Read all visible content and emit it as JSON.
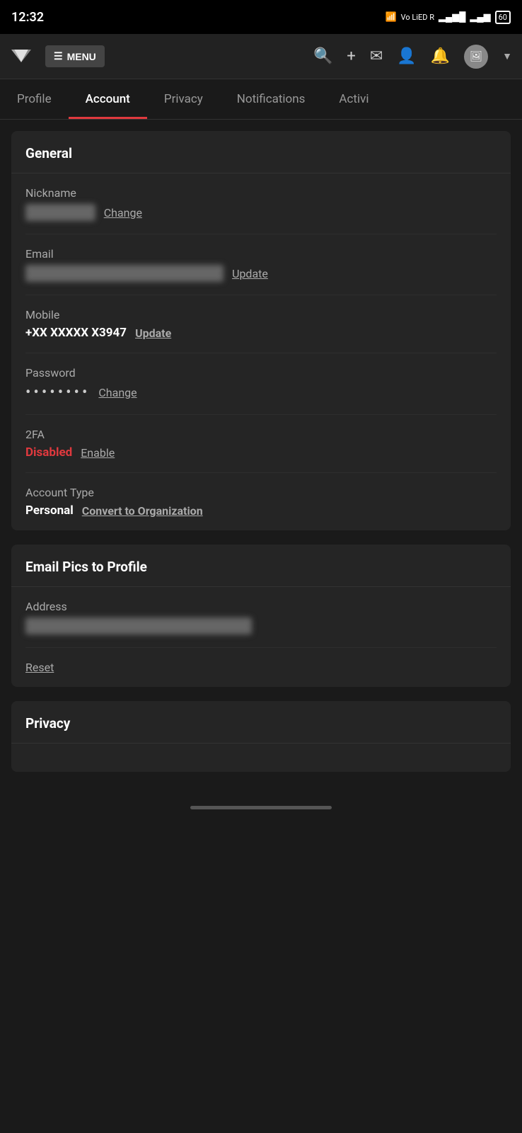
{
  "statusBar": {
    "time": "12:32",
    "batteryLevel": "60"
  },
  "topNav": {
    "menuLabel": "MENU",
    "logoSymbol": "🦊"
  },
  "tabs": [
    {
      "id": "profile",
      "label": "Profile",
      "active": false
    },
    {
      "id": "account",
      "label": "Account",
      "active": true
    },
    {
      "id": "privacy",
      "label": "Privacy",
      "active": false
    },
    {
      "id": "notifications",
      "label": "Notifications",
      "active": false
    },
    {
      "id": "activity",
      "label": "Activi",
      "active": false
    }
  ],
  "general": {
    "sectionTitle": "General",
    "fields": [
      {
        "id": "nickname",
        "label": "Nickname",
        "valueBlurred": true,
        "blurredContent": "██████ ██",
        "actionLabel": "Change"
      },
      {
        "id": "email",
        "label": "Email",
        "valueBlurred": true,
        "blurredContent": "████████████████████",
        "actionLabel": "Update"
      },
      {
        "id": "mobile",
        "label": "Mobile",
        "value": "+XX XXXXX X3947",
        "bold": true,
        "actionLabel": "Update"
      },
      {
        "id": "password",
        "label": "Password",
        "isDots": true,
        "dotsCount": 8,
        "actionLabel": "Change"
      },
      {
        "id": "twofa",
        "label": "2FA",
        "status": "Disabled",
        "statusClass": "disabled",
        "actionLabel": "Enable"
      },
      {
        "id": "accountType",
        "label": "Account Type",
        "value": "Personal",
        "bold": true,
        "actionLabel": "Convert to Organization"
      }
    ]
  },
  "emailPics": {
    "sectionTitle": "Email Pics to Profile",
    "fields": [
      {
        "id": "address",
        "label": "Address",
        "valueBlurred": true,
        "blurredContent": "████████████████████████████"
      },
      {
        "id": "reset",
        "actionLabel": "Reset"
      }
    ]
  },
  "privacy": {
    "sectionTitle": "Privacy"
  }
}
